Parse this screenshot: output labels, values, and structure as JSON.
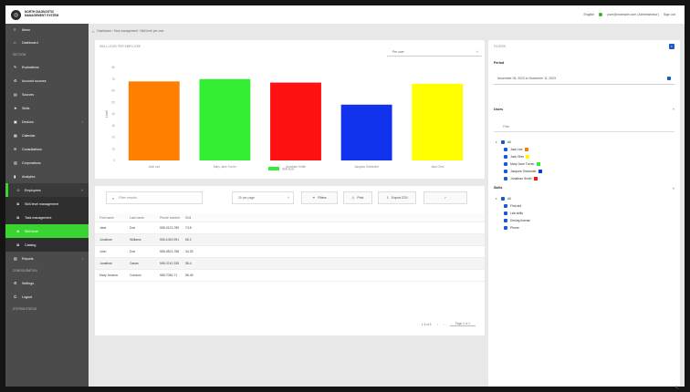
{
  "app": {
    "logo_text": "NORTH DIAGNOSTIC MANAGEMENT SYSTEM",
    "top_right": {
      "language": "English",
      "user": "user@example.com (Administrator)",
      "logout": "Sign out"
    }
  },
  "sidebar": {
    "menu_label": "Menu",
    "items": [
      {
        "label": "Dashboard",
        "icon": "home-icon"
      },
      {
        "section": "SECTION"
      },
      {
        "label": "Evaluations",
        "icon": "wrench-icon"
      },
      {
        "label": "Account sources",
        "icon": "gear-icon"
      },
      {
        "label": "Sources",
        "icon": "database-icon"
      },
      {
        "label": "Skills",
        "icon": "star-icon"
      },
      {
        "label": "Devices",
        "icon": "device-icon",
        "arrow": "›"
      },
      {
        "label": "Calendar",
        "icon": "calendar-icon"
      },
      {
        "label": "Consultations",
        "icon": "chat-icon"
      },
      {
        "label": "Corporations",
        "icon": "building-icon"
      },
      {
        "label": "Analytics",
        "icon": "chart-icon"
      },
      {
        "label": "Employees",
        "icon": "people-icon",
        "arrow": "˅"
      },
      {
        "label": "Skill level management",
        "icon": "list-icon",
        "sub": true
      },
      {
        "label": "Task management",
        "icon": "list-icon",
        "sub": true
      },
      {
        "label": "Skill level",
        "icon": "list-icon",
        "sub": true,
        "active": true
      },
      {
        "label": "Catalog",
        "icon": "list-icon",
        "sub": true
      },
      {
        "label": "Reports",
        "icon": "report-icon",
        "arrow": "›"
      },
      {
        "section": "CONFIGURATION"
      },
      {
        "label": "Settings",
        "icon": "gear-icon"
      },
      {
        "label": "Logout",
        "icon": "power-icon"
      },
      {
        "section": "SYSTEM STATUS"
      }
    ]
  },
  "breadcrumb": {
    "text": "Dashboard › Task management › Skill level per user"
  },
  "chart_card": {
    "title": "SKILL LEVEL PER EMPLOYEE",
    "select_value": "Per user"
  },
  "chart_data": {
    "type": "bar",
    "categories": [
      "Jack Lee",
      "Mary Jane Turner",
      "Jonathan Smith",
      "Jacques Ostrander",
      "Jack Ohm"
    ],
    "values": [
      68,
      70,
      67,
      48,
      66
    ],
    "colors": [
      "#ff8000",
      "#33ee33",
      "#ff1111",
      "#1133ee",
      "#ffff00"
    ],
    "ylim": [
      0,
      80
    ],
    "yticks": [
      0,
      10,
      20,
      30,
      40,
      50,
      60,
      70,
      80
    ],
    "ylabel": "Level",
    "legend": {
      "label": "Skill level",
      "color": "#33ee33",
      "position": "bottom"
    },
    "grid": false
  },
  "table_card": {
    "search_placeholder": "Filter results",
    "per_page": "25 per page",
    "buttons": {
      "filters": "Filters",
      "print": "Print",
      "export": "Export CSV",
      "edit": "✓"
    },
    "columns": [
      "First name",
      "Last name",
      "Phone number",
      "Skill"
    ],
    "rows": [
      [
        "Jane",
        "Doe",
        "555-0123-789",
        "74.8"
      ],
      [
        "Jonathan",
        "Williams",
        "555-1049-991",
        "65.2"
      ],
      [
        "John",
        "Doe",
        "555-0823-788",
        "34.25"
      ],
      [
        "Jonathan",
        "Gauss",
        "555-3742-335",
        "58.4"
      ],
      [
        "Mary Jessica",
        "Conduct",
        "555-7046-71",
        "58.45"
      ]
    ],
    "pager": {
      "rows": "1-5 of 5",
      "page": "Page 1 of 1"
    }
  },
  "right_panel": {
    "title": "FILTERS",
    "period_label": "Period",
    "period_value": "November 05, 2023 to November 11, 2023",
    "users_label": "Users",
    "users_filter_placeholder": "Filter",
    "users": {
      "root": "All",
      "items": [
        {
          "name": "Jack Lee",
          "color": "#ff8000"
        },
        {
          "name": "Jack Ohm",
          "color": "#ffff00"
        },
        {
          "name": "Mary Jane Turner",
          "color": "#33ee33"
        },
        {
          "name": "Jacques Ostrander",
          "color": "#1133ee"
        },
        {
          "name": "Jonathan Smith",
          "color": "#ff1111"
        }
      ]
    },
    "skills_label": "Skills",
    "skills": {
      "root": "All",
      "items": [
        "First aid",
        "Lab skills",
        "Driving license",
        "Phone"
      ]
    }
  }
}
